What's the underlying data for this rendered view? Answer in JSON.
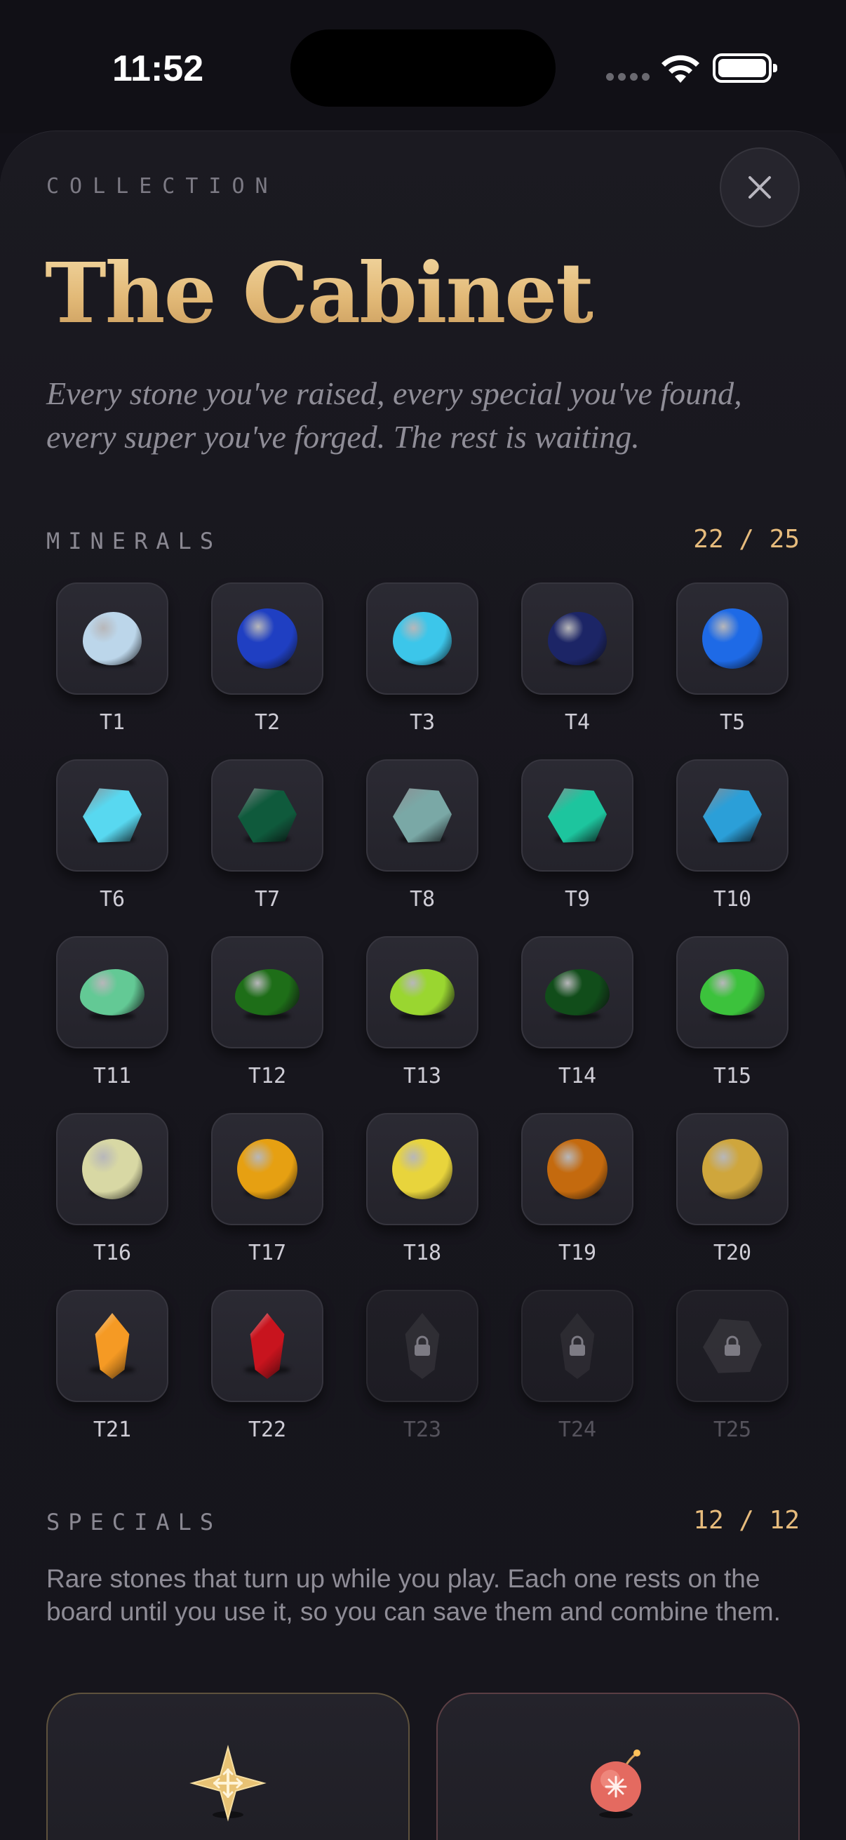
{
  "status": {
    "time": "11:52"
  },
  "header": {
    "eyebrow": "COLLECTION",
    "title": "The Cabinet",
    "subtitle": "Every stone you've raised, every special you've found, every super you've forged. The rest is waiting."
  },
  "minerals": {
    "label": "MINERALS",
    "count": "22 / 25",
    "items": [
      {
        "label": "T1",
        "shape": "round",
        "color": "#bcd6ea",
        "locked": false
      },
      {
        "label": "T2",
        "shape": "sphere",
        "color": "#1f3fc2",
        "locked": false
      },
      {
        "label": "T3",
        "shape": "round",
        "color": "#3cc6ea",
        "locked": false
      },
      {
        "label": "T4",
        "shape": "round",
        "color": "#1c2566",
        "locked": false
      },
      {
        "label": "T5",
        "shape": "sphere",
        "color": "#1e6ae6",
        "locked": false
      },
      {
        "label": "T6",
        "shape": "hex",
        "color": "#58d8f0",
        "locked": false
      },
      {
        "label": "T7",
        "shape": "hex",
        "color": "#0f5a3c",
        "locked": false
      },
      {
        "label": "T8",
        "shape": "hex",
        "color": "#7aa8a6",
        "locked": false
      },
      {
        "label": "T9",
        "shape": "hex",
        "color": "#1dc59e",
        "locked": false
      },
      {
        "label": "T10",
        "shape": "hex",
        "color": "#2b9fd8",
        "locked": false
      },
      {
        "label": "T11",
        "shape": "pebble",
        "color": "#63c995",
        "locked": false
      },
      {
        "label": "T12",
        "shape": "pebble",
        "color": "#1e6e18",
        "locked": false
      },
      {
        "label": "T13",
        "shape": "pebble",
        "color": "#9ad630",
        "locked": false
      },
      {
        "label": "T14",
        "shape": "pebble",
        "color": "#114d1a",
        "locked": false
      },
      {
        "label": "T15",
        "shape": "pebble",
        "color": "#3cc23c",
        "locked": false
      },
      {
        "label": "T16",
        "shape": "sphere",
        "color": "#d8d8a4",
        "locked": false
      },
      {
        "label": "T17",
        "shape": "sphere",
        "color": "#e6a012",
        "locked": false
      },
      {
        "label": "T18",
        "shape": "sphere",
        "color": "#e8d43c",
        "locked": false
      },
      {
        "label": "T19",
        "shape": "sphere",
        "color": "#c46a0e",
        "locked": false
      },
      {
        "label": "T20",
        "shape": "sphere",
        "color": "#cfa63c",
        "locked": false
      },
      {
        "label": "T21",
        "shape": "crystal",
        "color": "#f59a24",
        "locked": false
      },
      {
        "label": "T22",
        "shape": "crystal",
        "color": "#c8141e",
        "locked": false
      },
      {
        "label": "T23",
        "shape": "locked",
        "color": "#3a3940",
        "locked": true
      },
      {
        "label": "T24",
        "shape": "locked",
        "color": "#35343b",
        "locked": true
      },
      {
        "label": "T25",
        "shape": "locked",
        "color": "#3d3c43",
        "locked": true
      }
    ]
  },
  "specials": {
    "label": "SPECIALS",
    "count": "12 / 12",
    "description": "Rare stones that turn up while you play. Each one rests on the board until you use it, so you can save them and combine them.",
    "cards": [
      {
        "icon": "compass-star-icon",
        "color": "#e8c274"
      },
      {
        "icon": "bomb-icon",
        "color": "#e46a60"
      }
    ]
  },
  "colors": {
    "accent": "#e6bb7c",
    "background": "#121118"
  }
}
